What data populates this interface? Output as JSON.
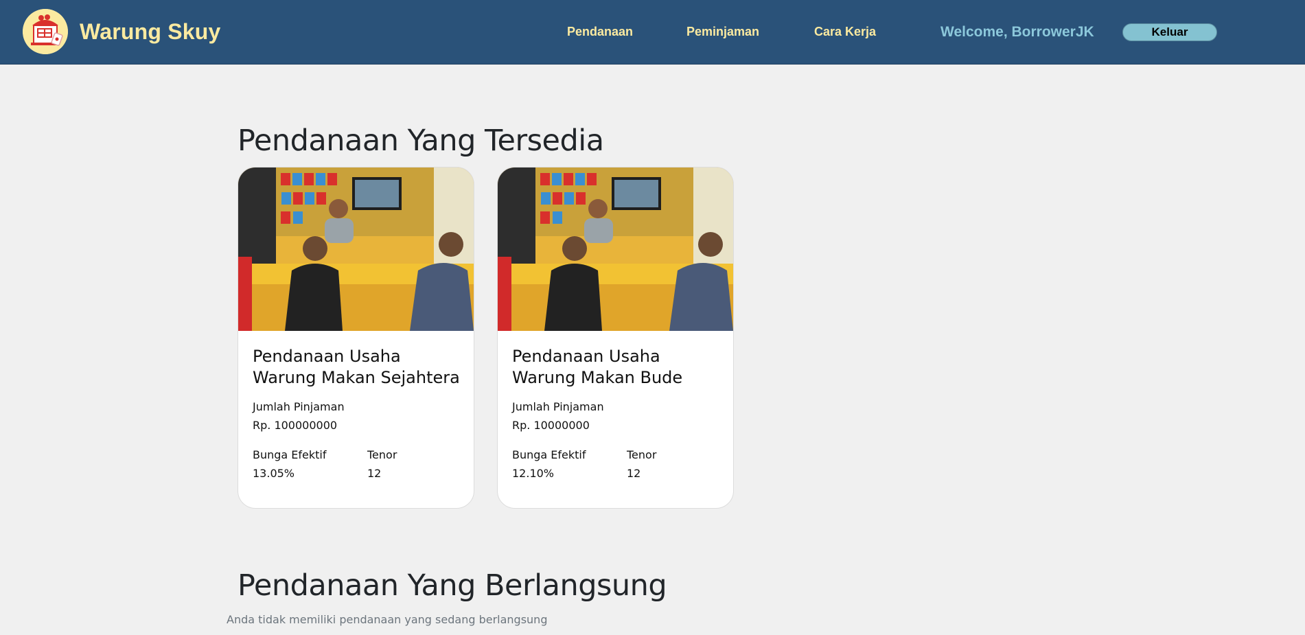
{
  "header": {
    "brand": "Warung Skuy",
    "nav": [
      {
        "label": "Pendanaan"
      },
      {
        "label": "Peminjaman"
      },
      {
        "label": "Cara Kerja"
      }
    ],
    "welcome": "Welcome, BorrowerJK",
    "logout_label": "Keluar"
  },
  "available": {
    "title": "Pendanaan Yang Tersedia",
    "cards": [
      {
        "title": "Pendanaan Usaha Warung Makan Sejahtera",
        "amount_label": "Jumlah Pinjaman",
        "amount": "Rp. 100000000",
        "rate_label": "Bunga Efektif",
        "rate": "13.05%",
        "tenor_label": "Tenor",
        "tenor": "12"
      },
      {
        "title": "Pendanaan Usaha Warung Makan Bude",
        "amount_label": "Jumlah Pinjaman",
        "amount": "Rp. 10000000",
        "rate_label": "Bunga Efektif",
        "rate": "12.10%",
        "tenor_label": "Tenor",
        "tenor": "12"
      }
    ]
  },
  "ongoing": {
    "title": "Pendanaan Yang Berlangsung",
    "empty_text": "Anda tidak memiliki pendanaan yang sedang berlangsung"
  }
}
